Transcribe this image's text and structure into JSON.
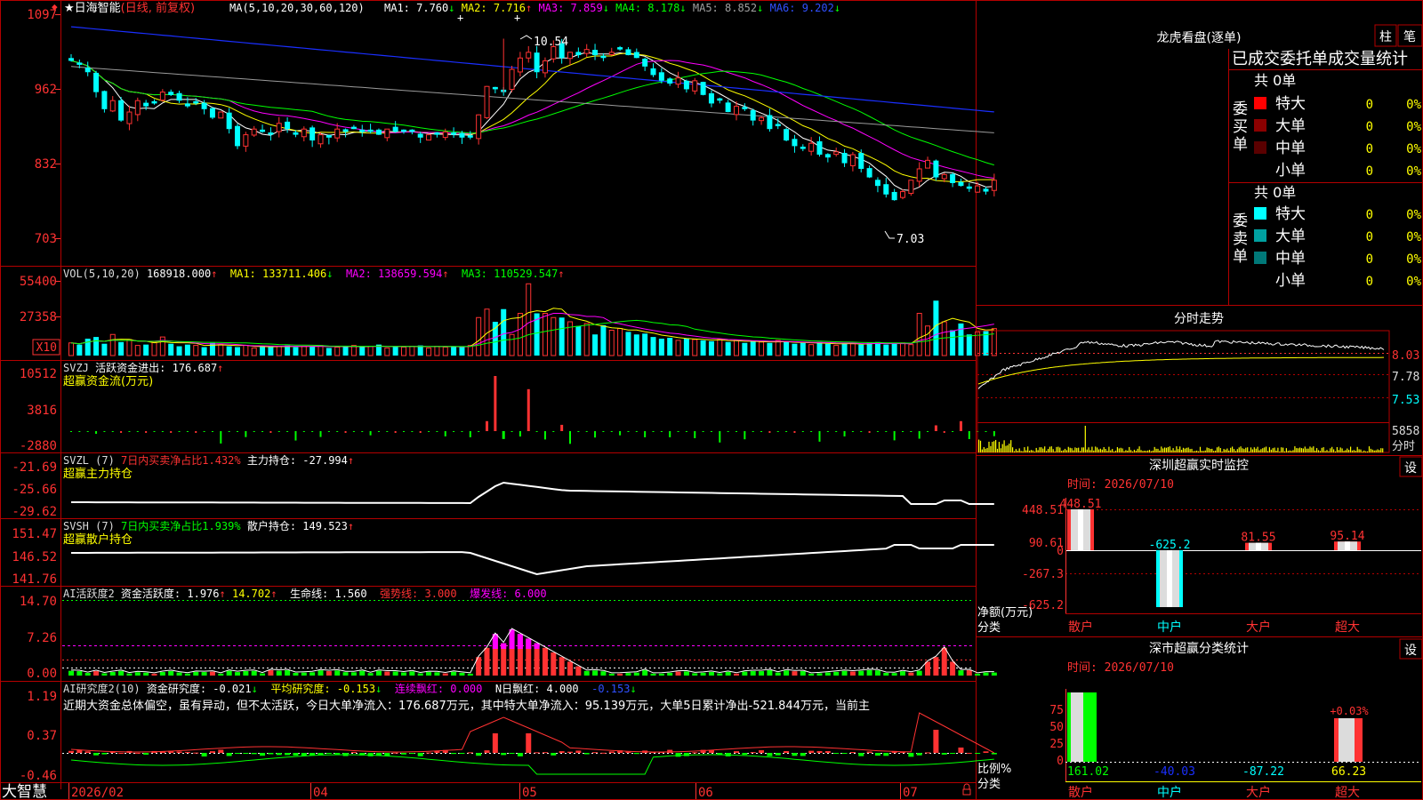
{
  "colors": {
    "up": "#ff3232",
    "down": "#00ffff",
    "grid": "#b40000",
    "axis_text": "#ff3232",
    "yellow": "#ffff00",
    "magenta": "#ff00ff",
    "green": "#00ff00",
    "blue": "#1a2fff",
    "white": "#ffffff",
    "gray": "#9a9a9a"
  },
  "header": {
    "star": "★",
    "stock_name": "日海智能",
    "period": "(日线, 前复权)",
    "ma_spec": "MA(5,10,20,30,60,120)",
    "ma_items": [
      {
        "label": "MA1: 7.760",
        "arrow": "↓",
        "color": "#ffffff"
      },
      {
        "label": "MA2: 7.716",
        "arrow": "↑",
        "color": "#ffff00"
      },
      {
        "label": "MA3: 7.859",
        "arrow": "↓",
        "color": "#ff00ff"
      },
      {
        "label": "MA4: 8.178",
        "arrow": "↓",
        "color": "#00ff00"
      },
      {
        "label": "MA5: 8.852",
        "arrow": "↓",
        "color": "#a0a0a0"
      },
      {
        "label": "MA6: 9.202",
        "arrow": "↓",
        "color": "#3050ff"
      }
    ]
  },
  "price_axis": [
    "1097",
    "962",
    "832",
    "703"
  ],
  "vol_axis": [
    "55400",
    "27358",
    "X10"
  ],
  "svzj_axis": [
    "10512",
    "3816",
    "-2880"
  ],
  "svzl_axis": [
    "-21.69",
    "-25.66",
    "-29.62"
  ],
  "svsh_axis": [
    "151.47",
    "146.52",
    "141.76"
  ],
  "ai1_axis": [
    "14.70",
    "7.26",
    "0.00"
  ],
  "ai2_axis": [
    "1.19",
    "0.37",
    "-0.46"
  ],
  "date_axis": [
    "2026/02",
    "04",
    "05",
    "06",
    "07"
  ],
  "app_logo": "大智慧",
  "annotations": {
    "high": "10.54",
    "low": "7.03"
  },
  "vol_header": {
    "spec": "VOL(5,10,20)",
    "value": "168918.000",
    "ma1": "MA1: 133711.406",
    "ma2": "MA2: 138659.594",
    "ma3": "MA3: 110529.547"
  },
  "svzj_header": {
    "name": "SVZJ",
    "label": "活跃资金进出: 176.687",
    "sub": "超赢资金流(万元)"
  },
  "svzl_header": {
    "name": "SVZL (7)",
    "ratio": "7日内买卖净占比1.432%",
    "label": "主力持仓: -27.994",
    "sub": "超赢主力持仓"
  },
  "svsh_header": {
    "name": "SVSH (7)",
    "ratio": "7日内买卖净占比1.939%",
    "label": "散户持仓: 149.523",
    "sub": "超赢散户持仓"
  },
  "ai1_header": {
    "name": "AI活跃度2",
    "label": "资金活跃度: 1.976",
    "v2": "14.702",
    "life": "生命线: 1.560",
    "strong": "强势线: 3.000",
    "burst": "爆发线: 6.000"
  },
  "ai2_header": {
    "name": "AI研究度2(10)",
    "label": "资金研究度: -0.021",
    "avg": "平均研究度: -0.153",
    "cont": "连续飘红: 0.000",
    "nday": "N日飘红: 4.000",
    "last": "-0.153"
  },
  "commentary": "近期大资金总体偏空，虽有异动，但不太活跃，今日大单净流入：176.687万元，其中特大单净流入：95.139万元，大单5日累计净出-521.844万元，当前主",
  "right_panel": {
    "longhu_title": "龙虎看盘(逐单)",
    "btn1": "柱",
    "btn2": "笔",
    "tabs_text": "已成交委托单成交量统计",
    "buy_total": "共 0单",
    "sell_total": "共 0单",
    "buy_label": "委买单",
    "sell_label": "委卖单",
    "buy_rows": [
      {
        "name": "特大",
        "count": "0",
        "pct": "0%",
        "color": "#ff0000"
      },
      {
        "name": "大单",
        "count": "0",
        "pct": "0%",
        "color": "#8b0000"
      },
      {
        "name": "中单",
        "count": "0",
        "pct": "0%",
        "color": "#5a0000"
      },
      {
        "name": "小单",
        "count": "0",
        "pct": "0%",
        "color": ""
      }
    ],
    "sell_rows": [
      {
        "name": "特大",
        "count": "0",
        "pct": "0%",
        "color": "#00ffff"
      },
      {
        "name": "大单",
        "count": "0",
        "pct": "0%",
        "color": "#00a0a0"
      },
      {
        "name": "中单",
        "count": "0",
        "pct": "0%",
        "color": "#007878"
      },
      {
        "name": "小单",
        "count": "0",
        "pct": "0%",
        "color": ""
      }
    ],
    "fenshi_title": "分时走势",
    "fenshi_axis": [
      "8.03",
      "7.78",
      "7.53"
    ],
    "fenshi_vol": [
      "5858",
      "分时"
    ],
    "sz_monitor_title": "深圳超赢实时监控",
    "sz_monitor_time": "时间: 2026/07/10",
    "set_label": "设",
    "sz_monitor_axis": [
      "448.51",
      "90.61",
      "0",
      "-267.3",
      "-625.2"
    ],
    "sz_monitor_ylabel": [
      "净额(万元)",
      "分类"
    ],
    "sz_cat_stats_title": "深市超赢分类统计",
    "sz_cat_stats_time": "时间: 2026/07/10",
    "sz_cat_axis": [
      "75",
      "50",
      "25",
      "0"
    ],
    "sz_cat_ylabel": [
      "比例%",
      "分类"
    ]
  },
  "chart_data": [
    {
      "type": "candlestick",
      "title": "日海智能 (日线, 前复权)",
      "x_range": [
        "2026/02",
        "2026/07"
      ],
      "ylim": [
        7.03,
        10.97
      ],
      "high": 10.54,
      "low": 7.03,
      "ma": {
        "MA1": 7.76,
        "MA2": 7.716,
        "MA3": 7.859,
        "MA4": 8.178,
        "MA5": 8.852,
        "MA6": 9.202
      },
      "closes": [
        10.15,
        10.08,
        9.95,
        9.6,
        9.3,
        9.45,
        9.1,
        9.25,
        9.45,
        9.35,
        9.4,
        9.6,
        9.55,
        9.45,
        9.35,
        9.4,
        9.3,
        9.15,
        9.25,
        8.95,
        8.65,
        8.85,
        8.95,
        8.9,
        8.85,
        9.05,
        8.95,
        8.85,
        8.95,
        8.75,
        8.85,
        8.8,
        8.95,
        8.9,
        8.95,
        8.9,
        8.9,
        8.85,
        8.95,
        8.9,
        8.9,
        8.9,
        8.8,
        8.85,
        8.85,
        8.9,
        8.85,
        8.8,
        8.8,
        9.2,
        9.7,
        9.65,
        9.6,
        10.0,
        10.2,
        10.3,
        9.95,
        10.15,
        10.4,
        10.2,
        10.3,
        10.25,
        10.35,
        10.25,
        10.2,
        10.3,
        10.35,
        10.25,
        10.2,
        10.05,
        9.9,
        9.8,
        9.75,
        9.85,
        9.65,
        9.8,
        9.55,
        9.4,
        9.45,
        9.25,
        9.35,
        9.3,
        9.1,
        9.15,
        8.95,
        9.0,
        8.75,
        8.65,
        8.6,
        8.7,
        8.5,
        8.45,
        8.55,
        8.35,
        8.5,
        8.25,
        8.1,
        7.95,
        7.8,
        7.7,
        7.85,
        8.05,
        8.25,
        8.4,
        8.1,
        8.15,
        8.0,
        7.95,
        7.9,
        7.95,
        7.85,
        8.05
      ]
    },
    {
      "type": "bar",
      "title": "VOL(5,10,20)",
      "value": 168918.0,
      "ma": {
        "MA1": 133711.406,
        "MA2": 138659.594,
        "MA3": 110529.547
      },
      "ylim": [
        0,
        55400
      ],
      "values": [
        1.5,
        1.3,
        2.0,
        2.2,
        1.4,
        2.5,
        1.6,
        1.9,
        1.2,
        1.3,
        1.6,
        2.2,
        1.4,
        1.1,
        1.3,
        1.2,
        1.0,
        1.5,
        1.3,
        1.1,
        1.0,
        1.2,
        0.9,
        1.1,
        1.0,
        1.1,
        1.2,
        1.0,
        1.1,
        1.1,
        1.2,
        0.9,
        1.0,
        1.1,
        1.2,
        1.0,
        1.1,
        1.3,
        0.9,
        1.1,
        1.0,
        1.1,
        1.2,
        0.9,
        1.1,
        1.0,
        1.1,
        1.0,
        1.2,
        4.5,
        5.5,
        4.0,
        5.5,
        2.5,
        5.0,
        8.5,
        5.0,
        5.0,
        4.5,
        4.5,
        4.0,
        3.5,
        3.8,
        2.5,
        3.6,
        3.0,
        3.2,
        2.8,
        2.5,
        2.6,
        2.2,
        2.0,
        2.1,
        1.8,
        2.0,
        1.9,
        1.8,
        1.7,
        1.9,
        1.6,
        1.8,
        1.5,
        1.7,
        1.6,
        1.5,
        1.8,
        1.6,
        1.4,
        1.5,
        1.3,
        1.6,
        1.4,
        1.2,
        1.5,
        1.4,
        1.3,
        1.5,
        1.6,
        1.3,
        1.4,
        1.5,
        1.3,
        5.0,
        3.5,
        6.5,
        4.0,
        3.0,
        3.8,
        2.5,
        2.8,
        3.0,
        3.2
      ]
    },
    {
      "type": "bar",
      "title": "SVZJ 活跃资金进出",
      "value": 176.687,
      "ylim": [
        -2880,
        10512
      ],
      "highlights": [
        {
          "index": 50,
          "value": 1900
        },
        {
          "index": 51,
          "value": 10512
        },
        {
          "index": 52,
          "value": -1500
        },
        {
          "index": 55,
          "value": 8000
        },
        {
          "index": 59,
          "value": 1200
        },
        {
          "index": 104,
          "value": 1100
        },
        {
          "index": 107,
          "value": 1900
        }
      ]
    },
    {
      "type": "line",
      "title": "SVZL 主力持仓",
      "value": -27.994,
      "ratio": "7日内买卖净占比1.432%",
      "ylim": [
        -29.62,
        -21.69
      ]
    },
    {
      "type": "line",
      "title": "SVSH 散户持仓",
      "value": 149.523,
      "ratio": "7日内买卖净占比1.939%",
      "ylim": [
        141.76,
        151.47
      ]
    },
    {
      "type": "bar",
      "title": "AI活跃度2",
      "value": 1.976,
      "second": 14.702,
      "life_line": 1.56,
      "strong_line": 3.0,
      "burst_line": 6.0,
      "ylim": [
        0.0,
        14.7
      ]
    },
    {
      "type": "bar",
      "title": "AI研究度2(10)",
      "value": -0.021,
      "avg": -0.153,
      "continuous_red": 0.0,
      "n_red": 4.0,
      "ylim": [
        -0.46,
        1.19
      ]
    },
    {
      "type": "bar",
      "title": "深圳超赢实时监控",
      "categories": [
        "散户",
        "中户",
        "大户",
        "超大"
      ],
      "values": [
        448.51,
        -625.2,
        81.55,
        95.14
      ],
      "ylabel": "净额(万元)",
      "ylim": [
        -625.2,
        448.51
      ]
    },
    {
      "type": "bar",
      "title": "深市超赢分类统计",
      "categories": [
        "散户",
        "中户",
        "大户",
        "超大"
      ],
      "values": [
        161.02,
        -40.03,
        -87.22,
        66.23
      ],
      "annotation": "+0.03%",
      "ylabel": "比例%",
      "ylim": [
        0,
        75
      ]
    }
  ]
}
